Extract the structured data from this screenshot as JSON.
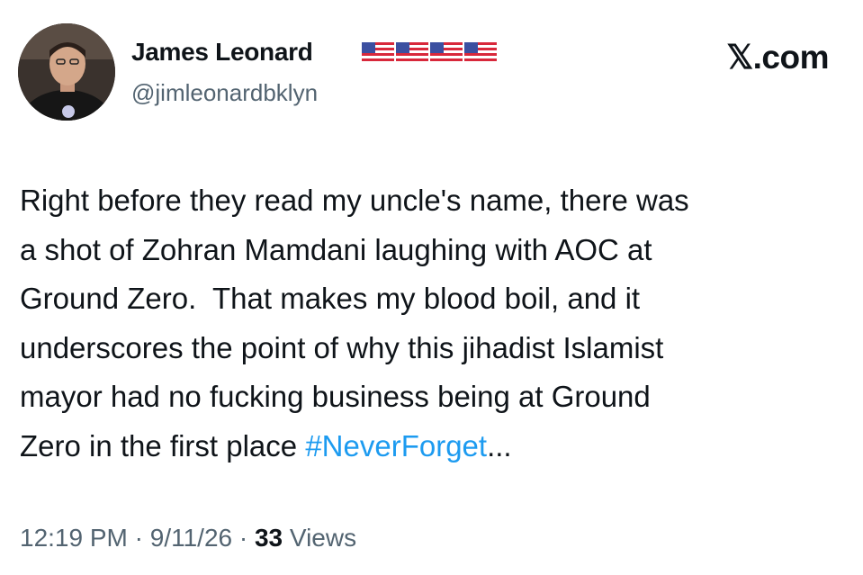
{
  "author": {
    "display_name": "James Leonard",
    "handle": "@jimleonardbklyn",
    "badges": [
      "us-flag-icon",
      "us-flag-icon",
      "us-flag-icon",
      "us-flag-icon"
    ]
  },
  "brand": "𝕏.com",
  "tweet": {
    "lines": [
      "Right before they read my uncle's name, there was",
      "a shot of Zohran Mamdani laughing with AOC at",
      "Ground Zero.  That makes my blood boil, and it",
      "underscores the point of why this jihadist Islamist",
      "mayor had no fucking business being at Ground",
      "Zero in the first place "
    ],
    "hashtag": "#NeverForget",
    "truncation": "..."
  },
  "meta": {
    "time": "12:19 PM",
    "sep1": " · ",
    "date": "9/11/26",
    "sep2": " · ",
    "views_count": "33",
    "views_label": " Views"
  },
  "colors": {
    "text": "#0f1419",
    "secondary": "#536471",
    "link": "#1d9bf0"
  }
}
